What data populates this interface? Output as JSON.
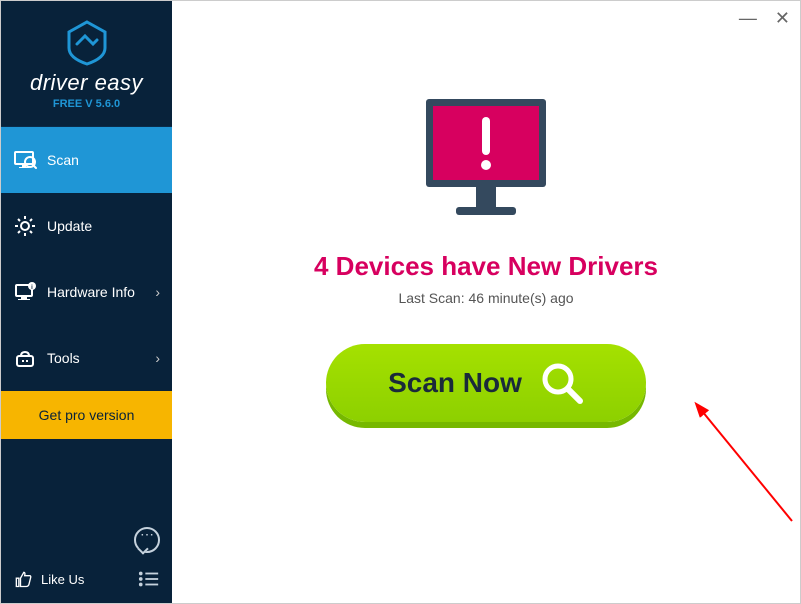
{
  "app": {
    "name": "driver easy",
    "version_label": "FREE V 5.6.0"
  },
  "sidebar": {
    "items": [
      {
        "label": "Scan",
        "icon": "scan-icon",
        "active": true,
        "expandable": false
      },
      {
        "label": "Update",
        "icon": "update-gear-icon",
        "active": false,
        "expandable": false
      },
      {
        "label": "Hardware Info",
        "icon": "hardware-info-icon",
        "active": false,
        "expandable": true
      },
      {
        "label": "Tools",
        "icon": "tools-icon",
        "active": false,
        "expandable": true
      }
    ],
    "pro_button_label": "Get pro version",
    "like_us_label": "Like Us"
  },
  "main": {
    "headline": "4 Devices have New Drivers",
    "last_scan": "Last Scan: 46 minute(s) ago",
    "scan_button_label": "Scan Now"
  },
  "colors": {
    "sidebar_bg": "#08223a",
    "active_bg": "#1f96d6",
    "pro_bg": "#f7b500",
    "accent_pink": "#d7005f",
    "scan_green": "#8dd000"
  }
}
